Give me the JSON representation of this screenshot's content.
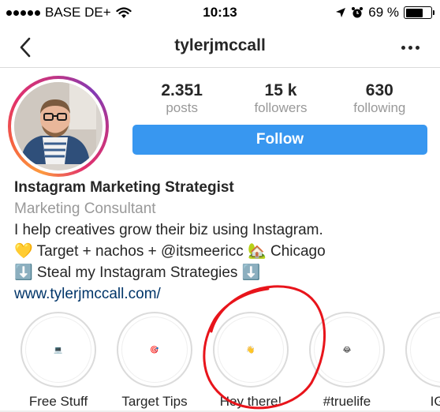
{
  "status_bar": {
    "carrier": "BASE DE+",
    "time": "10:13",
    "battery_text": "69 %",
    "battery_level": 0.69
  },
  "nav": {
    "title": "tylerjmccall",
    "back_icon": "chevron-left-icon",
    "more_icon": "more-horizontal-icon"
  },
  "profile": {
    "stats": [
      {
        "value": "2.351",
        "label": "posts"
      },
      {
        "value": "15 k",
        "label": "followers"
      },
      {
        "value": "630",
        "label": "following"
      }
    ],
    "follow_label": "Follow",
    "accent": "#3897f0"
  },
  "bio": {
    "name": "Instagram Marketing Strategist",
    "category": "Marketing Consultant",
    "line1": "I help creatives grow their biz using Instagram.",
    "line2": "💛 Target + nachos + @itsmeericc 🏡 Chicago",
    "line3": "⬇️ Steal my Instagram Strategies ⬇️",
    "link": "www.tylerjmccall.com/"
  },
  "highlights": [
    {
      "label": "Free Stuff",
      "icon": "💻"
    },
    {
      "label": "Target Tips",
      "icon": "🎯"
    },
    {
      "label": "Hey there!",
      "icon": "👋"
    },
    {
      "label": "#truelife",
      "icon": "😂"
    },
    {
      "label": "IG T",
      "icon": ""
    }
  ],
  "annotation_color": "#e8141b"
}
